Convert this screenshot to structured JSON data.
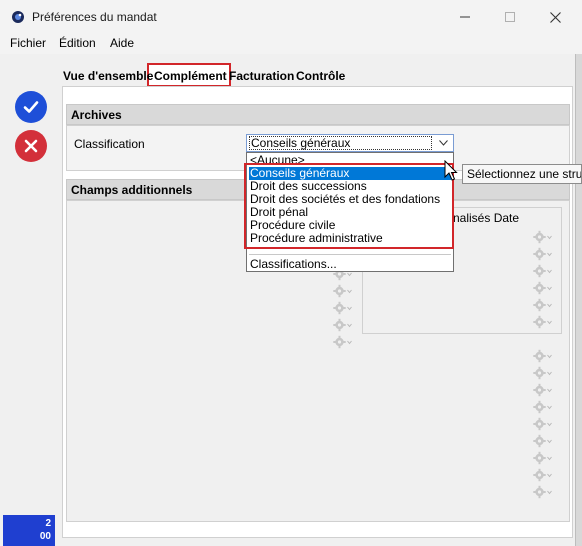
{
  "window": {
    "title": "Préférences du mandat",
    "minimize_icon": "minimize-icon",
    "maximize_icon": "maximize-icon",
    "close_icon": "close-icon"
  },
  "menu": [
    "Fichier",
    "Édition",
    "Aide"
  ],
  "left_panel": {
    "confirm_icon": "check-circle-icon",
    "cancel_icon": "x-circle-icon",
    "counter_line1": "2",
    "counter_line2": "00",
    "colors": {
      "confirm": "#1e4fd8",
      "cancel": "#d3303a",
      "counter_bg": "#1f3fd0"
    }
  },
  "tabs": [
    {
      "label": "Vue d'ensemble",
      "active": false
    },
    {
      "label": "Complément",
      "active": true
    },
    {
      "label": "Facturation",
      "active": false
    },
    {
      "label": "Contrôle",
      "active": false
    }
  ],
  "archives": {
    "header": "Archives",
    "classification_label": "Classification",
    "selected_value": "Conseils généraux",
    "options": [
      "<Aucune>",
      "Conseils généraux",
      "Droit des successions",
      "Droit des sociétés et des fondations",
      "Droit pénal",
      "Procédure civile",
      "Procédure administrative"
    ],
    "highlighted_option": "Conseils généraux",
    "manage_option": "Classifications...",
    "tooltip": "Sélectionnez une struc"
  },
  "champs": {
    "header": "Champs additionnels",
    "column_fragment": "nalisés Date",
    "gear_icon": "gear-dropdown-icon"
  },
  "accent_colors": {
    "highlight": "#0078d7",
    "annotation": "#d2262a"
  }
}
